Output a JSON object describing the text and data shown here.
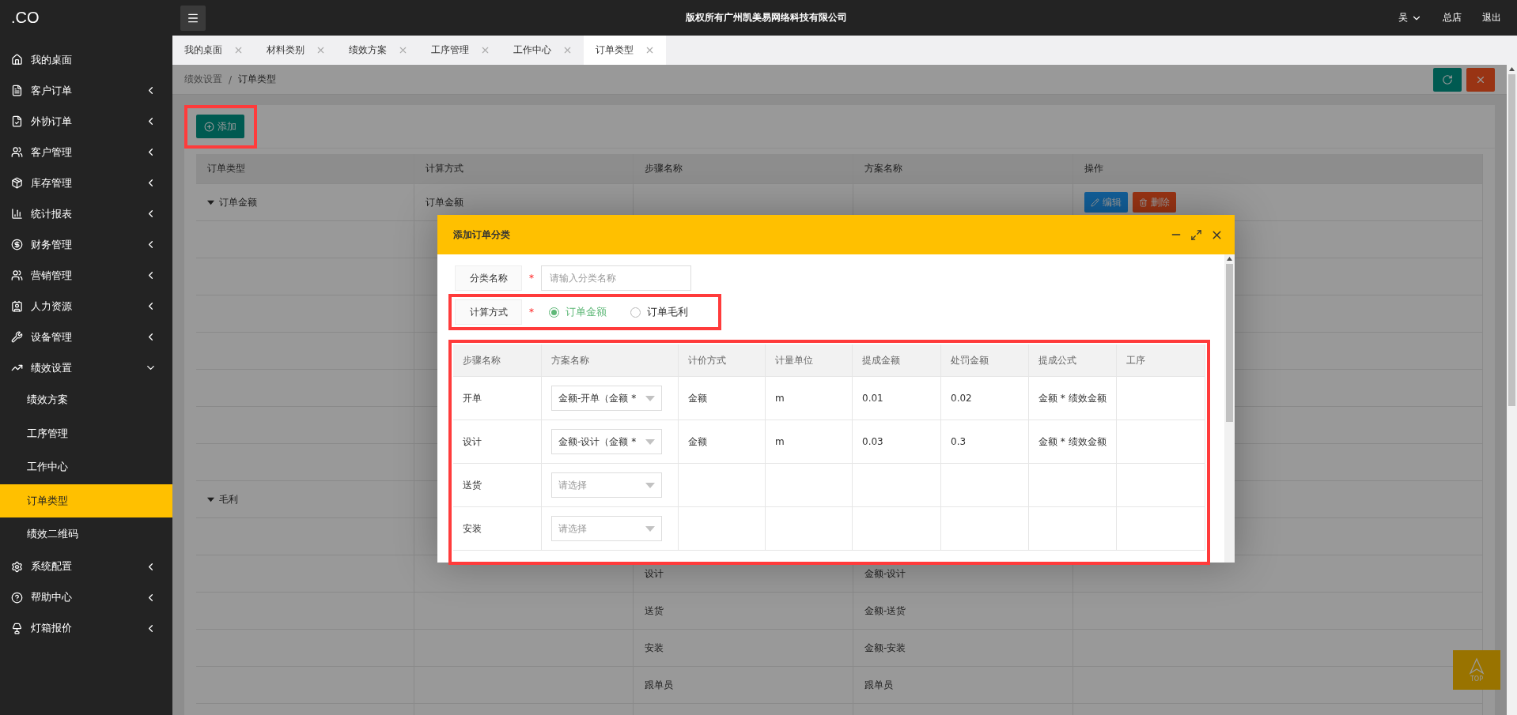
{
  "logo": ".CO",
  "header": {
    "title": "版权所有广州凯美易网络科技有限公司",
    "user": "吴",
    "store": "总店",
    "logout": "退出"
  },
  "sidebar": {
    "items": [
      {
        "label": "我的桌面",
        "selected": false
      },
      {
        "label": "客户订单",
        "selected": false,
        "expanded": false
      },
      {
        "label": "外协订单",
        "selected": false,
        "expanded": false
      },
      {
        "label": "客户管理",
        "selected": false,
        "expanded": false
      },
      {
        "label": "库存管理",
        "selected": false,
        "expanded": false
      },
      {
        "label": "统计报表",
        "selected": false,
        "expanded": false
      },
      {
        "label": "财务管理",
        "selected": false,
        "expanded": false
      },
      {
        "label": "营销管理",
        "selected": false,
        "expanded": false
      },
      {
        "label": "人力资源",
        "selected": false,
        "expanded": false
      },
      {
        "label": "设备管理",
        "selected": false,
        "expanded": false
      },
      {
        "label": "绩效设置",
        "selected": false,
        "expanded": true,
        "children": [
          {
            "label": "绩效方案",
            "selected": false
          },
          {
            "label": "工序管理",
            "selected": false
          },
          {
            "label": "工作中心",
            "selected": false
          },
          {
            "label": "订单类型",
            "selected": true
          },
          {
            "label": "绩效二维码",
            "selected": false
          }
        ]
      },
      {
        "label": "系统配置",
        "selected": false,
        "expanded": false
      },
      {
        "label": "帮助中心",
        "selected": false,
        "expanded": false
      },
      {
        "label": "灯箱报价",
        "selected": false,
        "expanded": false
      }
    ]
  },
  "tabs": [
    {
      "label": "我的桌面",
      "selected": false
    },
    {
      "label": "材料类别",
      "selected": false
    },
    {
      "label": "绩效方案",
      "selected": false
    },
    {
      "label": "工序管理",
      "selected": false
    },
    {
      "label": "工作中心",
      "selected": false
    },
    {
      "label": "订单类型",
      "selected": true
    }
  ],
  "breadcrumb": {
    "items": [
      "绩效设置",
      "订单类型"
    ],
    "separator": "/"
  },
  "toolbar": {
    "add_button": "添加"
  },
  "table": {
    "columns": [
      "订单类型",
      "计算方式",
      "步骤名称",
      "方案名称",
      "操作"
    ],
    "rows": [
      {
        "order_type": "订单金额",
        "expanded": true,
        "calc_method": "订单金额",
        "actions": [
          {
            "kind": "edit",
            "label": "编辑"
          },
          {
            "kind": "delete",
            "label": "删除"
          }
        ]
      },
      {},
      {},
      {},
      {},
      {},
      {},
      {},
      {
        "order_type": "毛利",
        "expanded": true
      },
      {},
      {
        "step": "设计",
        "scheme": "金额-设计"
      },
      {
        "step": "送货",
        "scheme": "金额-送货"
      },
      {
        "step": "安装",
        "scheme": "金额-安装"
      },
      {
        "step": "跟单员",
        "scheme": "跟单员"
      },
      {}
    ]
  },
  "dialog": {
    "title": "添加订单分类",
    "name_field": {
      "label": "分类名称",
      "required_mark": "*",
      "placeholder": "请输入分类名称"
    },
    "calc_field": {
      "label": "计算方式",
      "required_mark": "*",
      "options": [
        {
          "label": "订单金额",
          "selected": true
        },
        {
          "label": "订单毛利",
          "selected": false
        }
      ]
    },
    "table": {
      "columns": [
        "步骤名称",
        "方案名称",
        "计价方式",
        "计量单位",
        "提成金额",
        "处罚金额",
        "提成公式",
        "工序"
      ],
      "rows": [
        {
          "step": "开单",
          "scheme": {
            "value": "金额-开单（金额 *"
          },
          "pricing": "金额",
          "unit": "m",
          "commission": "0.01",
          "penalty": "0.02",
          "formula": "金额 * 绩效金额"
        },
        {
          "step": "设计",
          "scheme": {
            "value": "金额-设计（金额 *"
          },
          "pricing": "金额",
          "unit": "m",
          "commission": "0.03",
          "penalty": "0.3",
          "formula": "金额 * 绩效金额"
        },
        {
          "step": "送货",
          "scheme": {
            "placeholder": "请选择"
          }
        },
        {
          "step": "安装",
          "scheme": {
            "placeholder": "请选择"
          }
        }
      ]
    }
  },
  "back_to_top": "TOP"
}
